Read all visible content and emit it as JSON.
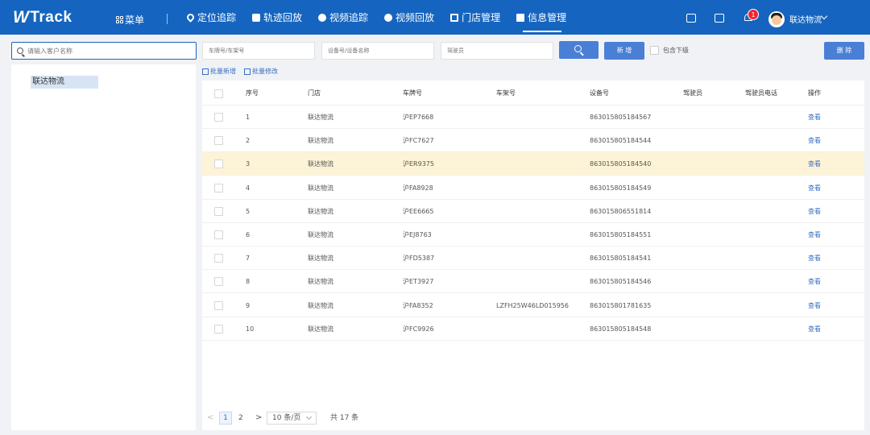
{
  "header": {
    "logo": "WTrack",
    "menu_label": "菜单",
    "nav": [
      {
        "label": "定位追踪",
        "icon": "location-pin-icon"
      },
      {
        "label": "轨迹回放",
        "icon": "track-replay-icon"
      },
      {
        "label": "视频追踪",
        "icon": "video-track-icon"
      },
      {
        "label": "视频回放",
        "icon": "video-replay-icon"
      },
      {
        "label": "门店管理",
        "icon": "store-icon"
      },
      {
        "label": "信息管理",
        "icon": "info-doc-icon",
        "active": true
      }
    ],
    "notification_count": "1",
    "user_name": "联达物流",
    "accent": "#1565c0"
  },
  "sidebar": {
    "search_placeholder": "请输入客户名称",
    "tree": [
      "联达物流"
    ]
  },
  "filters": {
    "plate_placeholder": "车牌号/车架号",
    "device_placeholder": "设备号/设备名称",
    "driver_placeholder": "驾驶员",
    "add_label": "新 增",
    "include_sub_label": "包含下级",
    "delete_label": "删 除",
    "batch_add_label": "批量新增",
    "batch_edit_label": "批量修改"
  },
  "table": {
    "columns": [
      "序号",
      "门店",
      "车牌号",
      "车架号",
      "设备号",
      "驾驶员",
      "驾驶员电话",
      "操作"
    ],
    "rows": [
      {
        "no": "1",
        "store": "联达物流",
        "plate": "沪EP7668",
        "vin": "",
        "device": "863015805184567",
        "driver": "",
        "phone": "",
        "action": "查看"
      },
      {
        "no": "2",
        "store": "联达物流",
        "plate": "沪FC7627",
        "vin": "",
        "device": "863015805184544",
        "driver": "",
        "phone": "",
        "action": "查看"
      },
      {
        "no": "3",
        "store": "联达物流",
        "plate": "沪ER9375",
        "vin": "",
        "device": "863015805184540",
        "driver": "",
        "phone": "",
        "action": "查看"
      },
      {
        "no": "4",
        "store": "联达物流",
        "plate": "沪FA8928",
        "vin": "",
        "device": "863015805184549",
        "driver": "",
        "phone": "",
        "action": "查看"
      },
      {
        "no": "5",
        "store": "联达物流",
        "plate": "沪EE6665",
        "vin": "",
        "device": "863015806551814",
        "driver": "",
        "phone": "",
        "action": "查看"
      },
      {
        "no": "6",
        "store": "联达物流",
        "plate": "沪EJ8763",
        "vin": "",
        "device": "863015805184551",
        "driver": "",
        "phone": "",
        "action": "查看"
      },
      {
        "no": "7",
        "store": "联达物流",
        "plate": "沪FD5387",
        "vin": "",
        "device": "863015805184541",
        "driver": "",
        "phone": "",
        "action": "查看"
      },
      {
        "no": "8",
        "store": "联达物流",
        "plate": "沪ET3927",
        "vin": "",
        "device": "863015805184546",
        "driver": "",
        "phone": "",
        "action": "查看"
      },
      {
        "no": "9",
        "store": "联达物流",
        "plate": "沪FA8352",
        "vin": "LZFH25W46LD015956",
        "device": "863015801781635",
        "driver": "",
        "phone": "",
        "action": "查看"
      },
      {
        "no": "10",
        "store": "联达物流",
        "plate": "沪FC9926",
        "vin": "",
        "device": "863015805184548",
        "driver": "",
        "phone": "",
        "action": "查看"
      }
    ],
    "highlight_row_color": "#fdf3d6"
  },
  "pagination": {
    "prev": "<",
    "pages": [
      "1",
      "2"
    ],
    "current": "1",
    "next": ">",
    "page_size": "10 条/页",
    "total": "共 17 条"
  }
}
